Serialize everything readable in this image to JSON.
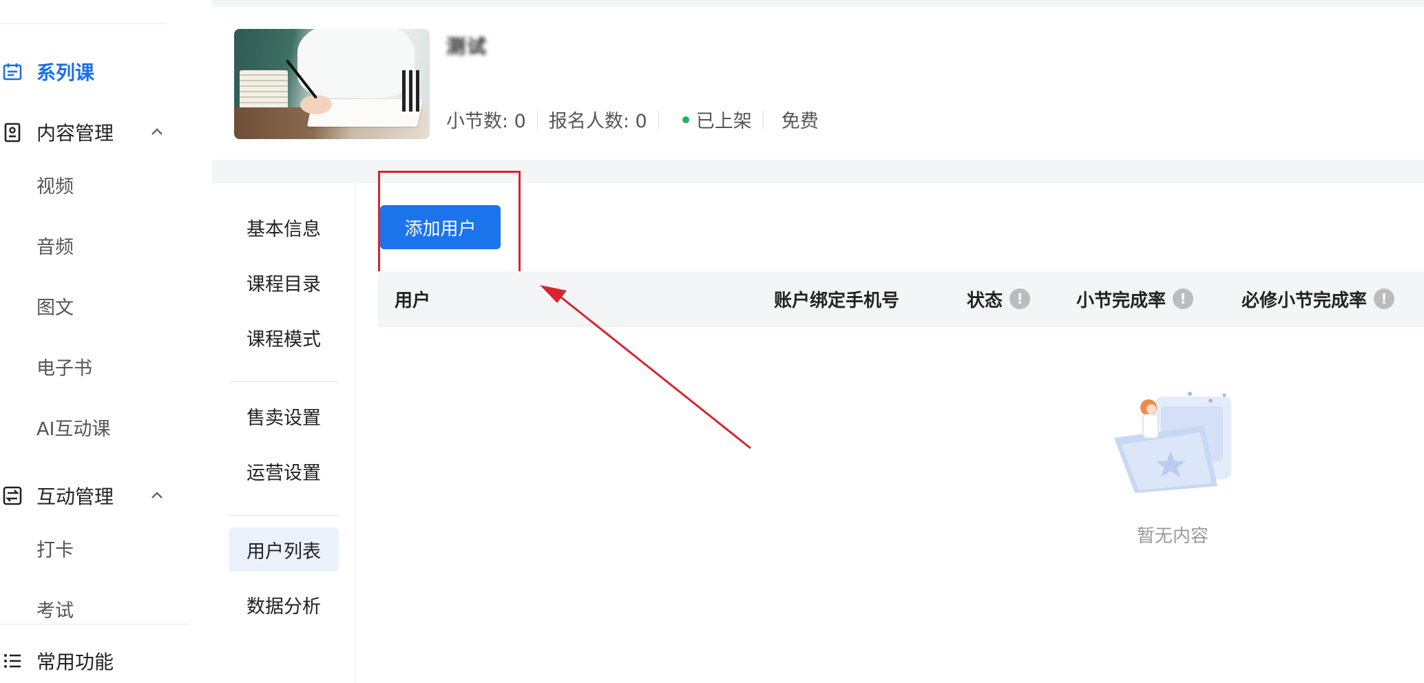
{
  "sidebar": {
    "items": [
      {
        "label": "系列课",
        "icon": "calendar-icon",
        "active": true
      },
      {
        "label": "内容管理",
        "icon": "content-doc-icon"
      },
      {
        "label": "互动管理",
        "icon": "interaction-icon"
      },
      {
        "label": "常用功能",
        "icon": "list-icon"
      }
    ],
    "content_sub": [
      "视频",
      "音频",
      "图文",
      "电子书",
      "AI互动课"
    ],
    "interaction_sub": [
      "打卡",
      "考试"
    ]
  },
  "course": {
    "title": "测试",
    "stats": {
      "sections": "小节数: 0",
      "enrolled": "报名人数: 0",
      "status": "已上架",
      "price": "免费"
    },
    "status_color": "#20b35a"
  },
  "subnav": {
    "items": [
      "基本信息",
      "课程目录",
      "课程模式",
      "售卖设置",
      "运营设置",
      "用户列表",
      "数据分析"
    ],
    "active": "用户列表"
  },
  "toolbar": {
    "add_user_label": "添加用户"
  },
  "table": {
    "columns": [
      "用户",
      "账户绑定手机号",
      "状态",
      "小节完成率",
      "必修小节完成率"
    ],
    "info_mark": "!"
  },
  "empty": {
    "text": "暂无内容"
  },
  "colors": {
    "accent": "#1b74ec",
    "annotation": "#d9232f"
  }
}
